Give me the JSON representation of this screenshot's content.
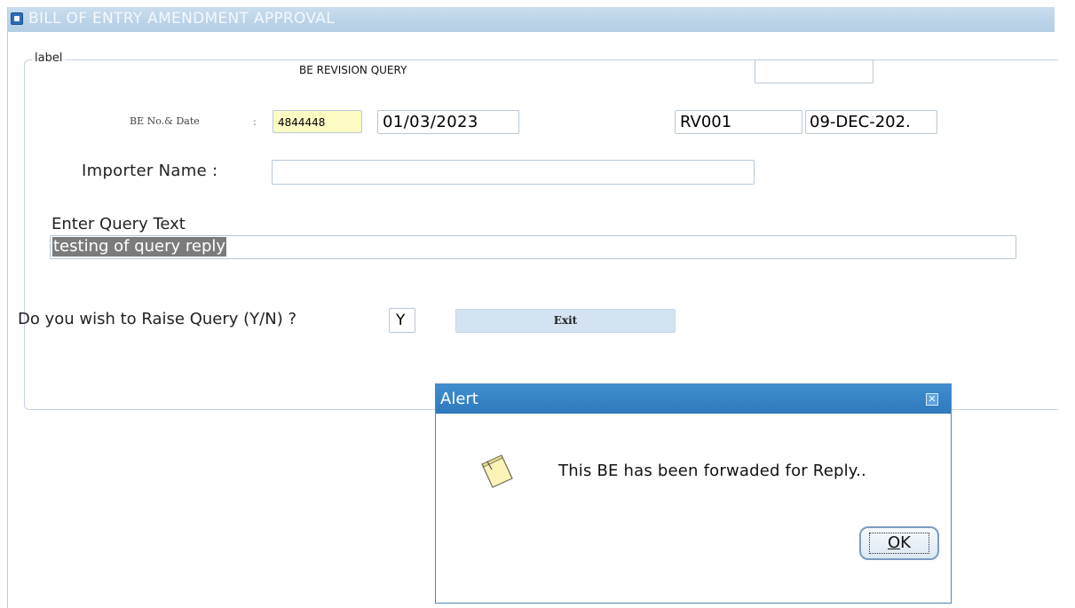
{
  "window": {
    "title": "BILL OF ENTRY AMENDMENT APPROVAL",
    "title_icon": "form-icon"
  },
  "form": {
    "group_label": "label",
    "section_title": "BE REVISION QUERY",
    "be_no_label": "BE No.& Date",
    "be_no_colon": ":",
    "be_no_value": "4844448",
    "be_date_value": "01/03/2023",
    "revision_code_value": "RV001",
    "revision_date_value": "09-DEC-202.",
    "importer_label": "Importer Name  :",
    "importer_value": "",
    "query_label": "Enter Query Text",
    "query_value": "testing of query reply",
    "raise_query_label": "Do you wish to Raise Query (Y/N) ?",
    "raise_query_value": "Y",
    "exit_label": "Exit"
  },
  "alert": {
    "title": "Alert",
    "close_glyph": "✕",
    "message": "This BE has been forwaded  for Reply..",
    "ok_mnemonic": "O",
    "ok_rest": "K",
    "icon": "note-icon"
  },
  "colors": {
    "titlebar": "#b3cde4",
    "alert_titlebar": "#2f78bc",
    "exit_button": "#d4e3f1",
    "be_no_field": "#fdfbc4",
    "query_highlight": "#7b7b7b"
  }
}
